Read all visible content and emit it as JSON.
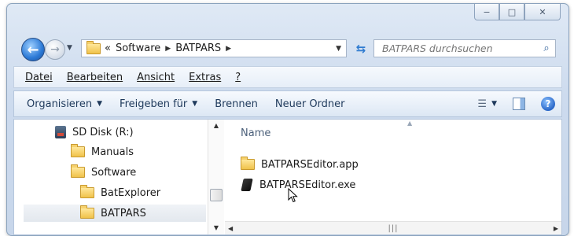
{
  "window": {
    "caption_buttons": [
      "minimize",
      "maximize",
      "close"
    ]
  },
  "navigation": {
    "back_icon": "back-arrow-icon",
    "forward_icon": "forward-arrow-icon",
    "address": {
      "overflow": "«",
      "crumbs": [
        "Software",
        "BATPARS"
      ]
    },
    "refresh_icon": "refresh-icon",
    "search_placeholder": "BATPARS durchsuchen"
  },
  "menubar": {
    "items": [
      "Datei",
      "Bearbeiten",
      "Ansicht",
      "Extras",
      "?"
    ]
  },
  "commandbar": {
    "organize": "Organisieren",
    "share": "Freigeben für",
    "burn": "Brennen",
    "new_folder": "Neuer Ordner"
  },
  "navpane": {
    "items": [
      {
        "label": "SD Disk (R:)",
        "icon": "drive-icon"
      },
      {
        "label": "Manuals",
        "icon": "folder-icon"
      },
      {
        "label": "Software",
        "icon": "folder-icon"
      },
      {
        "label": "BatExplorer",
        "icon": "folder-icon"
      },
      {
        "label": "BATPARS",
        "icon": "folder-icon",
        "selected": true
      }
    ]
  },
  "filepane": {
    "column_header": "Name",
    "files": [
      {
        "name": "BATPARSEditor.app",
        "icon": "folder-icon"
      },
      {
        "name": "BATPARSEditor.exe",
        "icon": "executable-icon"
      }
    ]
  },
  "colors": {
    "window_frame": "#cddbee",
    "commandbar_text": "#1e395b",
    "accent_blue": "#2b79d6"
  }
}
